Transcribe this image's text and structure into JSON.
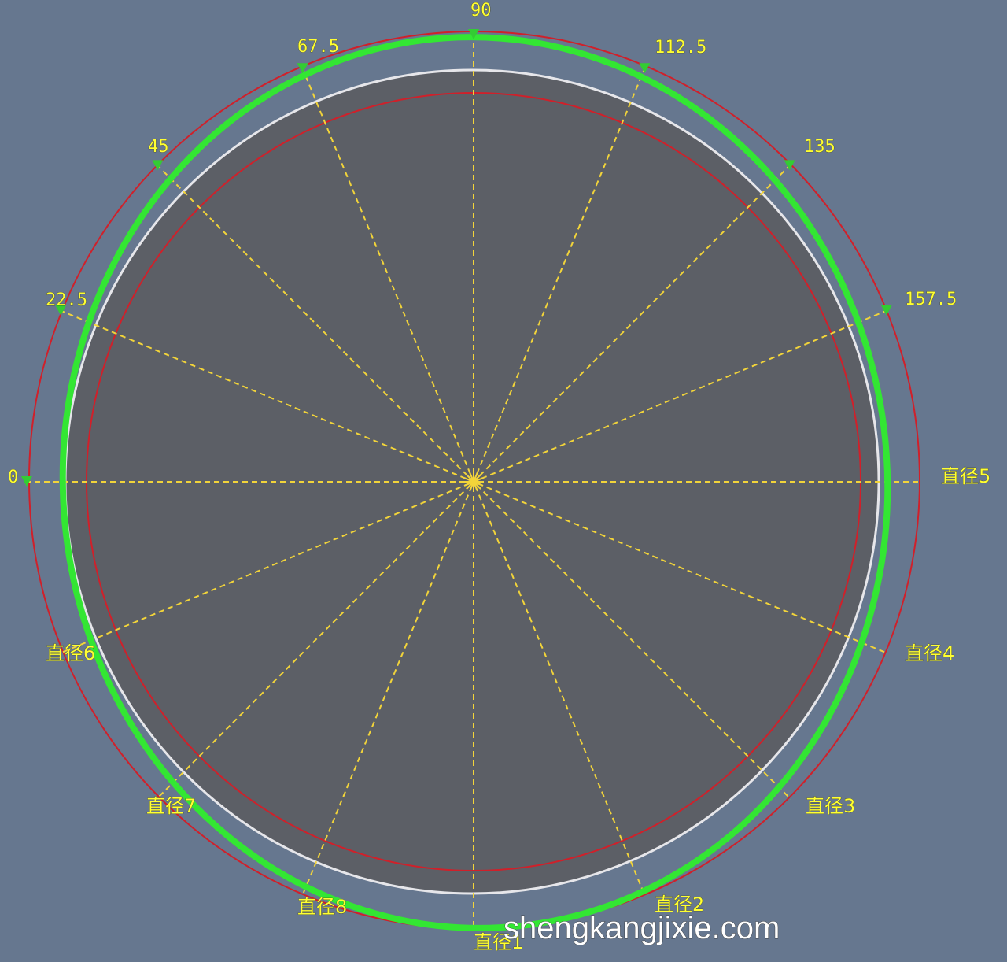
{
  "colors": {
    "background": "#66778f",
    "disc": "#5c5f66",
    "outer_red_circle": "#d0202a",
    "inner_red_circle": "#d0202a",
    "white_circle": "#e6e6ea",
    "green_profile": "#33e633",
    "radial_lines": "#f2d43a",
    "label_text": "#ffff33",
    "marker": "#33cc33"
  },
  "angle_labels": [
    "0",
    "22.5",
    "45",
    "67.5",
    "90",
    "112.5",
    "135",
    "157.5"
  ],
  "diameter_labels": [
    "直径1",
    "直径2",
    "直径3",
    "直径4",
    "直径5",
    "直径6",
    "直径7",
    "直径8"
  ],
  "center_marker_icon": "center-point-icon",
  "direction_marker_icon": "arrow-marker-icon",
  "watermark": "shengkangjixie.com"
}
